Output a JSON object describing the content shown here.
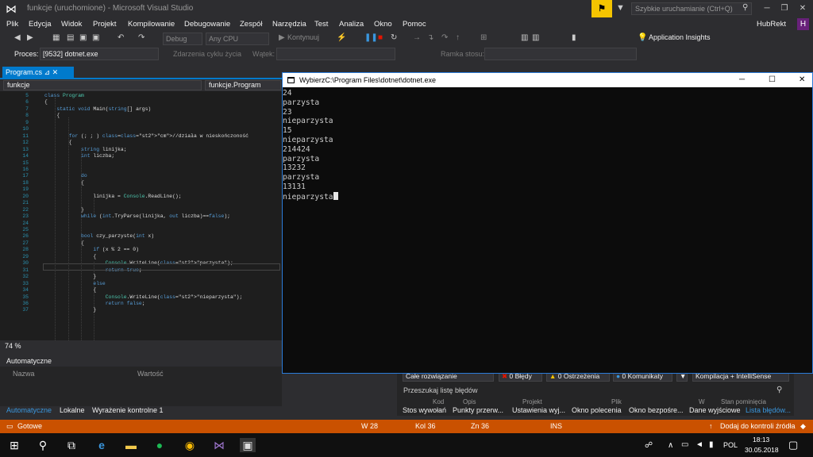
{
  "window": {
    "title": "funkcje (uruchomione) - Microsoft Visual Studio",
    "quick_launch": "Szybkie uruchamianie (Ctrl+Q)",
    "account": "HubRekt",
    "avatar": "H"
  },
  "menu": [
    "Plik",
    "Edycja",
    "Widok",
    "Projekt",
    "Kompilowanie",
    "Debugowanie",
    "Zespół",
    "Narzędzia",
    "Test",
    "Analiza",
    "Okno",
    "Pomoc"
  ],
  "toolbar": {
    "config": "Debug",
    "platform": "Any CPU",
    "continue": "Kontynuuj",
    "app_insights": "Application Insights"
  },
  "toolbar2": {
    "process_label": "Proces:",
    "process_value": "[9532] dotnet.exe",
    "lifecycle": "Zdarzenia cyklu życia",
    "thread": "Wątek:",
    "stack": "Ramka stosu:"
  },
  "editor": {
    "tab": "Program.cs",
    "nav_left": "funkcje",
    "nav_right": "funkcje.Program",
    "zoom": "74 %"
  },
  "code_lines": [
    {
      "n": "5",
      "t": "class Program"
    },
    {
      "n": "6",
      "t": "{"
    },
    {
      "n": "7",
      "t": "    static void Main(string[] args)"
    },
    {
      "n": "8",
      "t": "    {"
    },
    {
      "n": "9",
      "t": ""
    },
    {
      "n": "10",
      "t": ""
    },
    {
      "n": "11",
      "t": "        for (; ; ) //działa w nieskończoność"
    },
    {
      "n": "12",
      "t": "        {"
    },
    {
      "n": "13",
      "t": "            string linijka;"
    },
    {
      "n": "14",
      "t": "            int liczba;"
    },
    {
      "n": "15",
      "t": ""
    },
    {
      "n": "16",
      "t": ""
    },
    {
      "n": "17",
      "t": "            do"
    },
    {
      "n": "18",
      "t": "            {"
    },
    {
      "n": "19",
      "t": ""
    },
    {
      "n": "20",
      "t": "                linijka = Console.ReadLine();"
    },
    {
      "n": "21",
      "t": ""
    },
    {
      "n": "22",
      "t": "            }"
    },
    {
      "n": "23",
      "t": "            while (int.TryParse(linijka, out liczba)==false);"
    },
    {
      "n": "24",
      "t": ""
    },
    {
      "n": "25",
      "t": ""
    },
    {
      "n": "26",
      "t": "            bool czy_parzyste(int x)"
    },
    {
      "n": "27",
      "t": "            {"
    },
    {
      "n": "28",
      "t": "                if (x % 2 == 0)"
    },
    {
      "n": "29",
      "t": "                {"
    },
    {
      "n": "30",
      "t": "                    Console.WriteLine(\"parzysta\");"
    },
    {
      "n": "31",
      "t": "                    return true;"
    },
    {
      "n": "32",
      "t": "                }"
    },
    {
      "n": "33",
      "t": "                else"
    },
    {
      "n": "34",
      "t": "                {"
    },
    {
      "n": "35",
      "t": "                    Console.WriteLine(\"nieparzysta\");"
    },
    {
      "n": "36",
      "t": "                    return false;"
    },
    {
      "n": "37",
      "t": "                }"
    }
  ],
  "autos": {
    "title": "Automatyczne",
    "col_name": "Nazwa",
    "col_value": "Wartość"
  },
  "bottom_tabs": [
    "Automatyczne",
    "Lokalne",
    "Wyrażenie kontrolne 1"
  ],
  "errorlist": {
    "scope": "Całe rozwiązanie",
    "errors": "0 Błędy",
    "warnings": "0 Ostrzeżenia",
    "messages": "0 Komunikaty",
    "build": "Kompilacja + IntelliSense",
    "search": "Przeszukaj listę błędów",
    "cols": [
      "Kod",
      "Opis",
      "Projekt",
      "Plik",
      "W",
      "Stan pominięcia"
    ]
  },
  "right_tabs": [
    "Stos wywołań",
    "Punkty przerw...",
    "Ustawienia wyj...",
    "Okno polecenia",
    "Okno bezpośre...",
    "Dane wyjściowe",
    "Lista błędów..."
  ],
  "status": {
    "ready": "Gotowe",
    "line": "W 28",
    "col": "Kol 36",
    "ch": "Zn 36",
    "ins": "INS",
    "source": "Dodaj do kontroli źródła"
  },
  "console": {
    "title": "WybierzC:\\Program Files\\dotnet\\dotnet.exe",
    "lines": [
      "24",
      "parzysta",
      "23",
      "nieparzysta",
      "15",
      "nieparzysta",
      "214424",
      "parzysta",
      "13232",
      "parzysta",
      "13131",
      "nieparzysta"
    ]
  },
  "taskbar": {
    "lang": "POL",
    "time": "18:13",
    "date": "30.05.2018"
  }
}
